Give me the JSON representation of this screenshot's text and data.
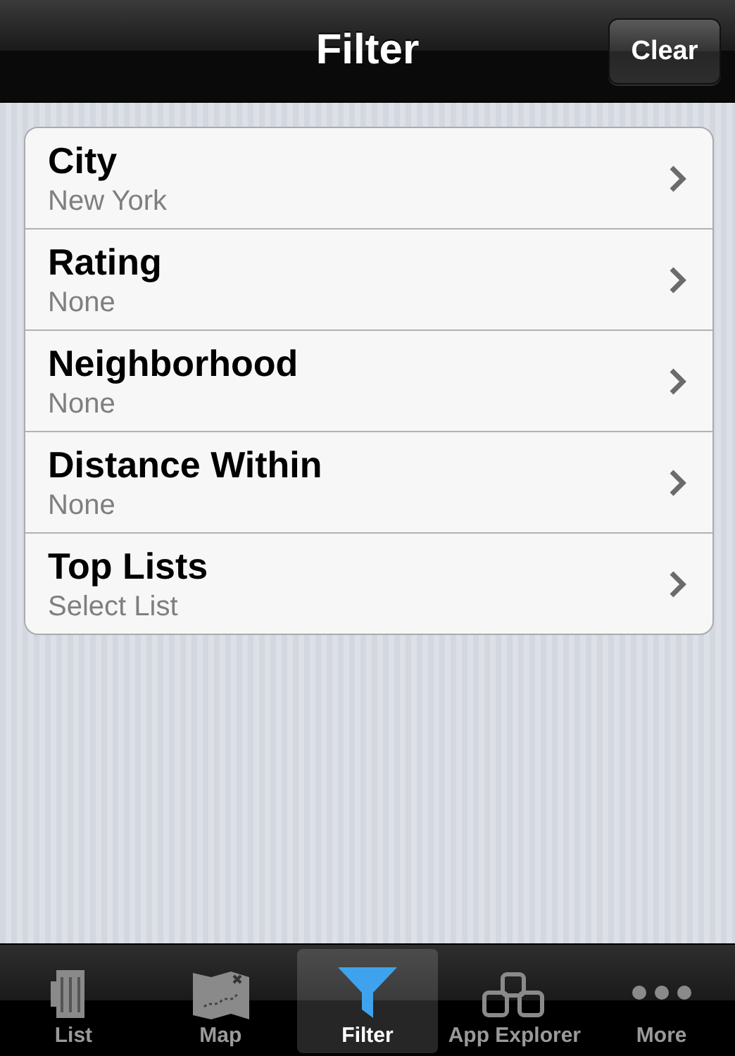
{
  "nav_bar": {
    "title": "Filter",
    "clear_button": "Clear"
  },
  "filters": [
    {
      "label": "City",
      "value": "New York"
    },
    {
      "label": "Rating",
      "value": "None"
    },
    {
      "label": "Neighborhood",
      "value": "None"
    },
    {
      "label": "Distance Within",
      "value": "None"
    },
    {
      "label": "Top Lists",
      "value": "Select List"
    }
  ],
  "tab_bar": [
    {
      "label": "List",
      "kind": "mug",
      "selected": false
    },
    {
      "label": "Map",
      "kind": "map",
      "selected": false
    },
    {
      "label": "Filter",
      "kind": "funnel",
      "selected": true
    },
    {
      "label": "App Explorer",
      "kind": "boxes",
      "selected": false
    },
    {
      "label": "More",
      "kind": "dots",
      "selected": false
    }
  ]
}
